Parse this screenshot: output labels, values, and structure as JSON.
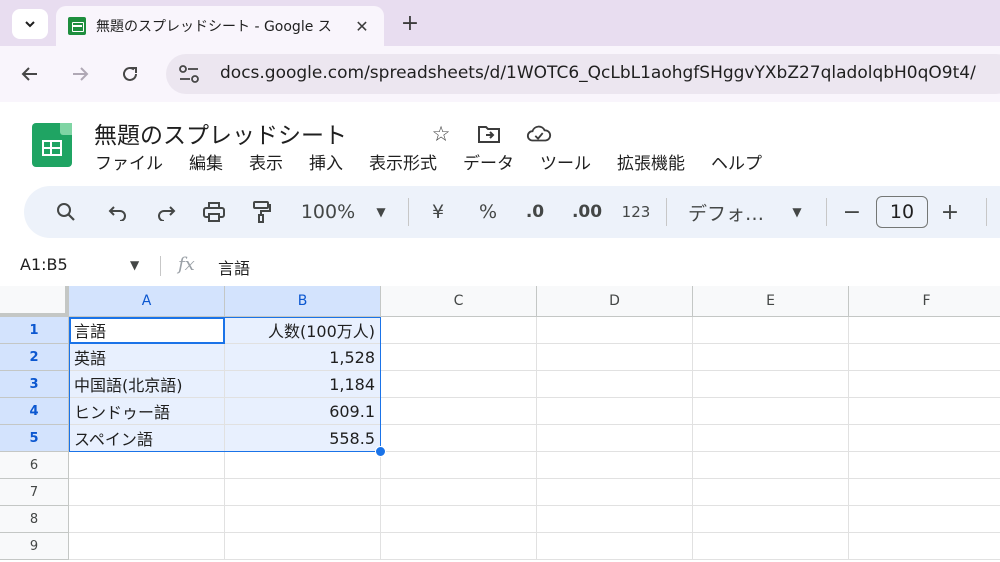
{
  "browser": {
    "tab_title": "無題のスプレッドシート - Google ス",
    "url": "docs.google.com/spreadsheets/d/1WOTC6_QcLbL1aohgfSHggvYXbZ27qladolqbH0qO9t4/"
  },
  "doc": {
    "title": "無題のスプレッドシート"
  },
  "menu": [
    {
      "label": "ファイル"
    },
    {
      "label": "編集"
    },
    {
      "label": "表示"
    },
    {
      "label": "挿入"
    },
    {
      "label": "表示形式"
    },
    {
      "label": "データ"
    },
    {
      "label": "ツール"
    },
    {
      "label": "拡張機能"
    },
    {
      "label": "ヘルプ"
    }
  ],
  "toolbar": {
    "zoom": "100%",
    "currency": "¥",
    "percent": "%",
    "decrease_decimal": ".0",
    "increase_decimal": ".00",
    "number_format": "123",
    "font": "デフォ…",
    "font_size": "10",
    "minus": "−",
    "plus": "+"
  },
  "formula_bar": {
    "name_box": "A1:B5",
    "fx": "fx",
    "value": "言語"
  },
  "sheet": {
    "columns": [
      "A",
      "B",
      "C",
      "D",
      "E",
      "F"
    ],
    "rows": [
      "1",
      "2",
      "3",
      "4",
      "5",
      "6",
      "7",
      "8",
      "9"
    ],
    "cells": [
      {
        "a": "言語",
        "b": "人数(100万人)"
      },
      {
        "a": "英語",
        "b": "1,528"
      },
      {
        "a": "中国語(北京語)",
        "b": "1,184"
      },
      {
        "a": "ヒンドゥー語",
        "b": "609.1"
      },
      {
        "a": "スペイン語",
        "b": "558.5"
      }
    ],
    "selection": "A1:B5",
    "colors": {
      "selection_fill": "#e8f0fe",
      "selection_border": "#1a73e8",
      "header_selected": "#d3e3fd"
    }
  }
}
